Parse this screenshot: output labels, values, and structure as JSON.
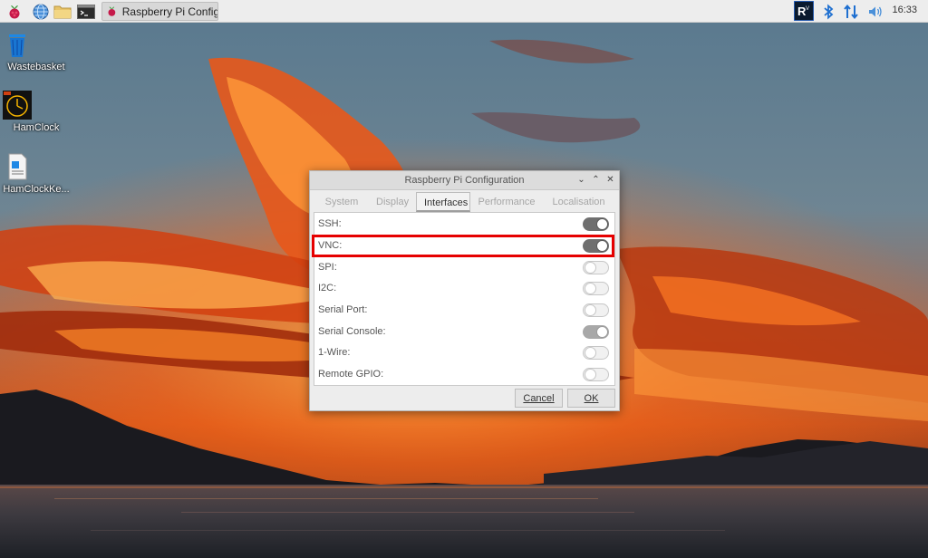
{
  "panel": {
    "task_button_label": "Raspberry Pi Configu...",
    "clock": "16:33",
    "launchers": [
      "raspberry-menu-icon",
      "browser-globe-icon",
      "file-manager-icon",
      "terminal-icon"
    ],
    "tray": [
      "realvnc-icon",
      "bluetooth-icon",
      "network-updown-icon",
      "volume-icon"
    ]
  },
  "desktop": {
    "icons": [
      {
        "label": "Wastebasket",
        "icon": "wastebasket-icon"
      },
      {
        "label": "HamClock",
        "icon": "hamclock-icon"
      },
      {
        "label": "HamClockKe...",
        "icon": "document-icon"
      }
    ]
  },
  "dialog": {
    "title": "Raspberry Pi Configuration",
    "window_buttons": [
      "minimize",
      "maximize",
      "close"
    ],
    "tabs": [
      {
        "label": "System",
        "active": false
      },
      {
        "label": "Display",
        "active": false
      },
      {
        "label": "Interfaces",
        "active": true
      },
      {
        "label": "Performance",
        "active": false
      },
      {
        "label": "Localisation",
        "active": false
      }
    ],
    "interfaces": [
      {
        "label": "SSH:",
        "enabled": true
      },
      {
        "label": "VNC:",
        "enabled": true
      },
      {
        "label": "SPI:",
        "enabled": false
      },
      {
        "label": "I2C:",
        "enabled": false
      },
      {
        "label": "Serial Port:",
        "enabled": false
      },
      {
        "label": "Serial Console:",
        "enabled": true
      },
      {
        "label": "1-Wire:",
        "enabled": false
      },
      {
        "label": "Remote GPIO:",
        "enabled": false
      }
    ],
    "cancel_label": "Cancel",
    "ok_label": "OK"
  },
  "colors": {
    "highlight": "#e60000",
    "toggle_on": "#6f6f6f",
    "panel_bg": "#ededed",
    "rpi_red": "#c51a4a"
  }
}
